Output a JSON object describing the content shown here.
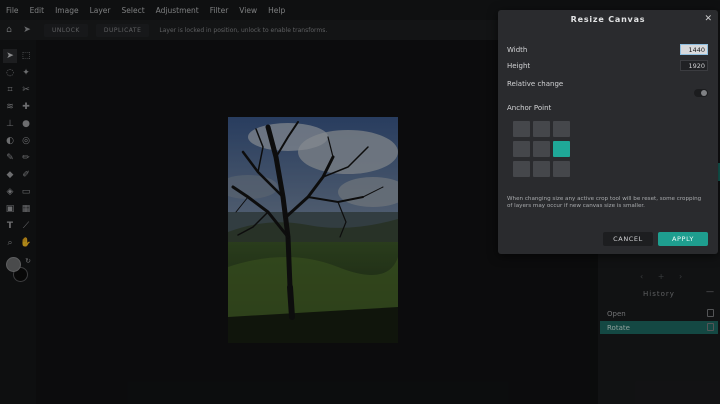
{
  "menubar": {
    "items": [
      "File",
      "Edit",
      "Image",
      "Layer",
      "Select",
      "Adjustment",
      "Filter",
      "View",
      "Help"
    ]
  },
  "optionsbar": {
    "home_icon": "home-icon",
    "move_icon": "move-tool-icon",
    "unlock_label": "UNLOCK",
    "duplicate_label": "DUPLICATE",
    "message": "Layer is locked in position, unlock to enable transforms."
  },
  "toolbar": {
    "tools": [
      "move-tool",
      "marquee-tool",
      "lasso-tool",
      "magic-wand-tool",
      "crop-tool",
      "cut-tool",
      "liquify-tool",
      "healing-tool",
      "stamp-tool",
      "blur-tool",
      "dodge-tool",
      "sponge-tool",
      "brush-tool",
      "pencil-tool",
      "eraser-tool",
      "color-replace-tool",
      "fill-tool",
      "shape-tool",
      "frame-tool",
      "gradient-tool",
      "text-tool",
      "eyedropper-tool",
      "zoom-tool",
      "hand-tool"
    ]
  },
  "dialog": {
    "title": "Resize Canvas",
    "width_label": "Width",
    "width_value": "1440",
    "height_label": "Height",
    "height_value": "1920",
    "relative_label": "Relative change",
    "relative_on": false,
    "anchor_label": "Anchor Point",
    "anchor_selected": "middle-right",
    "note": "When changing size any active crop tool will be reset, some cropping of layers may occur if new canvas size is smaller.",
    "cancel_label": "CANCEL",
    "apply_label": "APPLY"
  },
  "history": {
    "header": "History",
    "items": [
      {
        "label": "Open",
        "active": false
      },
      {
        "label": "Rotate",
        "active": true
      }
    ]
  },
  "colors": {
    "accent": "#1fa898",
    "history_active": "#1e6b63",
    "dialog_bg": "#2a2b2e"
  }
}
